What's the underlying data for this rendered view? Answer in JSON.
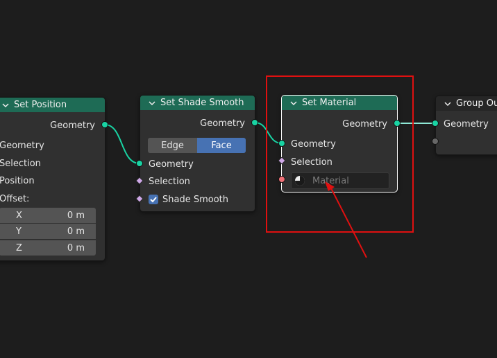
{
  "nodes": {
    "set_position": {
      "title": "Set Position",
      "output_geometry": "Geometry",
      "inputs": [
        "Geometry",
        "Selection",
        "Position",
        "Offset:"
      ],
      "offset": [
        {
          "axis": "X",
          "value": "0 m"
        },
        {
          "axis": "Y",
          "value": "0 m"
        },
        {
          "axis": "Z",
          "value": "0 m"
        }
      ]
    },
    "set_shade_smooth": {
      "title": "Set Shade Smooth",
      "output_geometry": "Geometry",
      "domain_options": [
        "Edge",
        "Face"
      ],
      "domain_selected": "Face",
      "input_geometry": "Geometry",
      "input_selection": "Selection",
      "shade_smooth_label": "Shade Smooth",
      "shade_smooth_checked": true
    },
    "set_material": {
      "title": "Set Material",
      "output_geometry": "Geometry",
      "input_geometry": "Geometry",
      "input_selection": "Selection",
      "material_placeholder": "Material"
    },
    "group_output": {
      "title": "Group Ou",
      "input_geometry": "Geometry"
    }
  },
  "colors": {
    "background": "#1d1d1d",
    "node_body": "#303030",
    "geometry_header": "#1e6b55",
    "geometry_socket": "#19d3a3",
    "selection_socket": "#cfa8e8",
    "material_socket": "#ef6f75",
    "face_selected": "#4772b3",
    "annotation": "#e01010"
  }
}
